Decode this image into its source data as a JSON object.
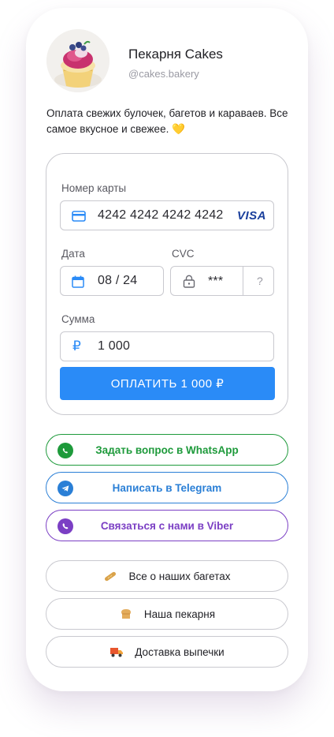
{
  "profile": {
    "name": "Пекарня Cakes",
    "handle": "@cakes.bakery",
    "description": "Оплата свежих булочек, багетов и караваев. Все самое вкусное и свежее. 💛"
  },
  "payment": {
    "card_label": "Номер карты",
    "card_number": "4242 4242 4242 4242",
    "card_brand": "VISA",
    "date_label": "Дата",
    "date_value": "08 / 24",
    "cvc_label": "CVC",
    "cvc_value": "***",
    "cvc_help": "?",
    "amount_label": "Сумма",
    "currency_symbol": "₽",
    "amount_value": "1 000",
    "pay_button": "ОПЛАТИТЬ 1 000 ₽"
  },
  "messengers": [
    {
      "label": "Задать вопрос в WhatsApp",
      "icon": "whatsapp-icon",
      "color": "#1e9a3b"
    },
    {
      "label": "Написать в Telegram",
      "icon": "telegram-icon",
      "color": "#2a7fd6"
    },
    {
      "label": "Связаться с нами в Viber",
      "icon": "viber-icon",
      "color": "#7b3fc4"
    }
  ],
  "links": [
    {
      "label": "Все о наших багетах",
      "icon": "baguette-icon"
    },
    {
      "label": "Наша пекарня",
      "icon": "bread-icon"
    },
    {
      "label": "Доставка выпечки",
      "icon": "delivery-truck-icon"
    }
  ],
  "colors": {
    "accent": "#2a8bf7",
    "whatsapp": "#1e9a3b",
    "telegram": "#2a7fd6",
    "viber": "#7b3fc4",
    "border": "#c9c9cf"
  }
}
